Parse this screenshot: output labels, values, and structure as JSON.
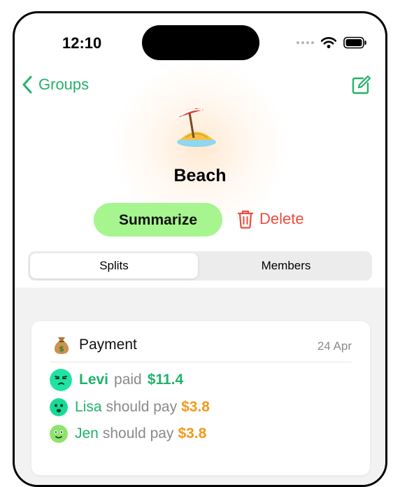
{
  "status_bar": {
    "time": "12:10"
  },
  "nav": {
    "back_label": "Groups"
  },
  "group": {
    "emoji": "beach-umbrella-icon",
    "title": "Beach"
  },
  "actions": {
    "summarize_label": "Summarize",
    "delete_label": "Delete"
  },
  "tabs": [
    {
      "label": "Splits",
      "active": true
    },
    {
      "label": "Members",
      "active": false
    }
  ],
  "card": {
    "icon": "money-bag-icon",
    "title": "Payment",
    "date": "24 Apr",
    "rows": [
      {
        "name": "Levi",
        "verb": "paid",
        "amount": "$11.4",
        "amount_color": "#1fb36b",
        "avatar_color": "#1fe3a0"
      },
      {
        "name": "Lisa",
        "verb": "should pay",
        "amount": "$3.8",
        "amount_color": "#f29a1c",
        "avatar_color": "#19d996"
      },
      {
        "name": "Jen",
        "verb": "should pay",
        "amount": "$3.8",
        "amount_color": "#f29a1c",
        "avatar_color": "#8de36b"
      }
    ]
  },
  "colors": {
    "accent": "#25b26a",
    "summarize_bg": "#a6f58f",
    "delete": "#ec4d3f"
  }
}
